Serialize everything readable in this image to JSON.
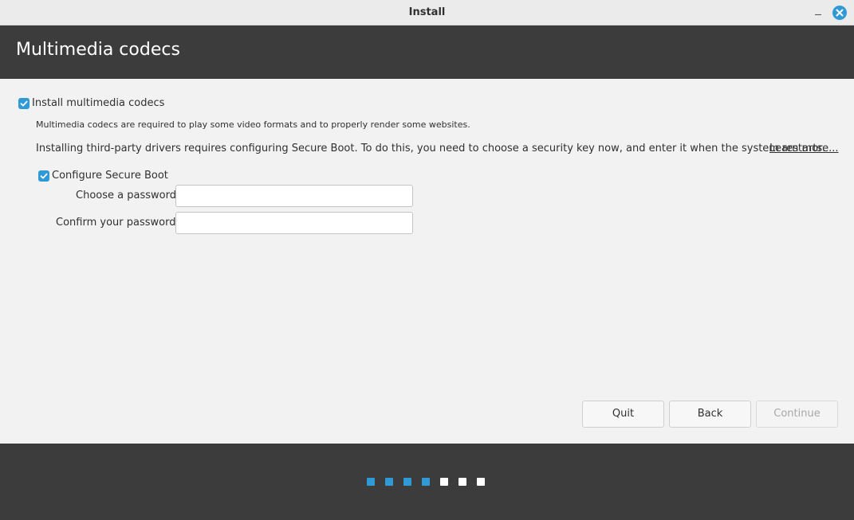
{
  "window": {
    "title": "Install"
  },
  "header": {
    "heading": "Multimedia codecs"
  },
  "codecs": {
    "checkbox_label": "Install multimedia codecs",
    "checked": true,
    "description": "Multimedia codecs are required to play some video formats and to properly render some websites."
  },
  "secure_boot": {
    "notice": "Installing third-party drivers requires configuring Secure Boot. To do this, you need to choose a security key now, and enter it when the system restarts.",
    "learn_more": "Learn more...",
    "checkbox_label": "Configure Secure Boot",
    "checked": true,
    "password_label": "Choose a password:",
    "password_value": "",
    "confirm_label": "Confirm your password:",
    "confirm_value": ""
  },
  "buttons": {
    "quit": "Quit",
    "back": "Back",
    "continue": "Continue"
  },
  "progress": {
    "total_steps": 7,
    "completed_steps": 4,
    "active_color": "#2f9ad6",
    "inactive_color": "#ffffff"
  },
  "colors": {
    "accent": "#2f9ad6",
    "header_bg": "#3c3c3c",
    "content_bg": "#f2f2f2"
  },
  "icons": {
    "close": "close-icon",
    "minimize": "minimize-icon",
    "checkbox": "checkmark-icon"
  }
}
